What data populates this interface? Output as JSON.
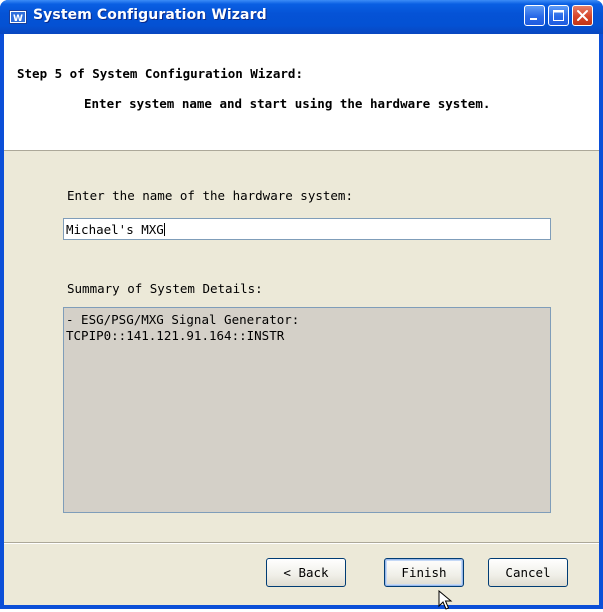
{
  "window": {
    "title": "System Configuration Wizard"
  },
  "header": {
    "step_title": "Step 5 of System Configuration Wizard:",
    "step_description": "Enter system name and start using the hardware system."
  },
  "form": {
    "name_label": "Enter the name of the hardware system:",
    "name_value": "Michael's MXG",
    "summary_label": "Summary of System Details:",
    "summary_lines": [
      "- ESG/PSG/MXG Signal Generator:",
      "TCPIP0::141.121.91.164::INSTR"
    ]
  },
  "buttons": {
    "back": "< Back",
    "finish": "Finish",
    "cancel": "Cancel"
  },
  "colors": {
    "titlebar": "#0451d3",
    "client_background": "#ece9d8",
    "summary_background": "#d4d0c8"
  }
}
